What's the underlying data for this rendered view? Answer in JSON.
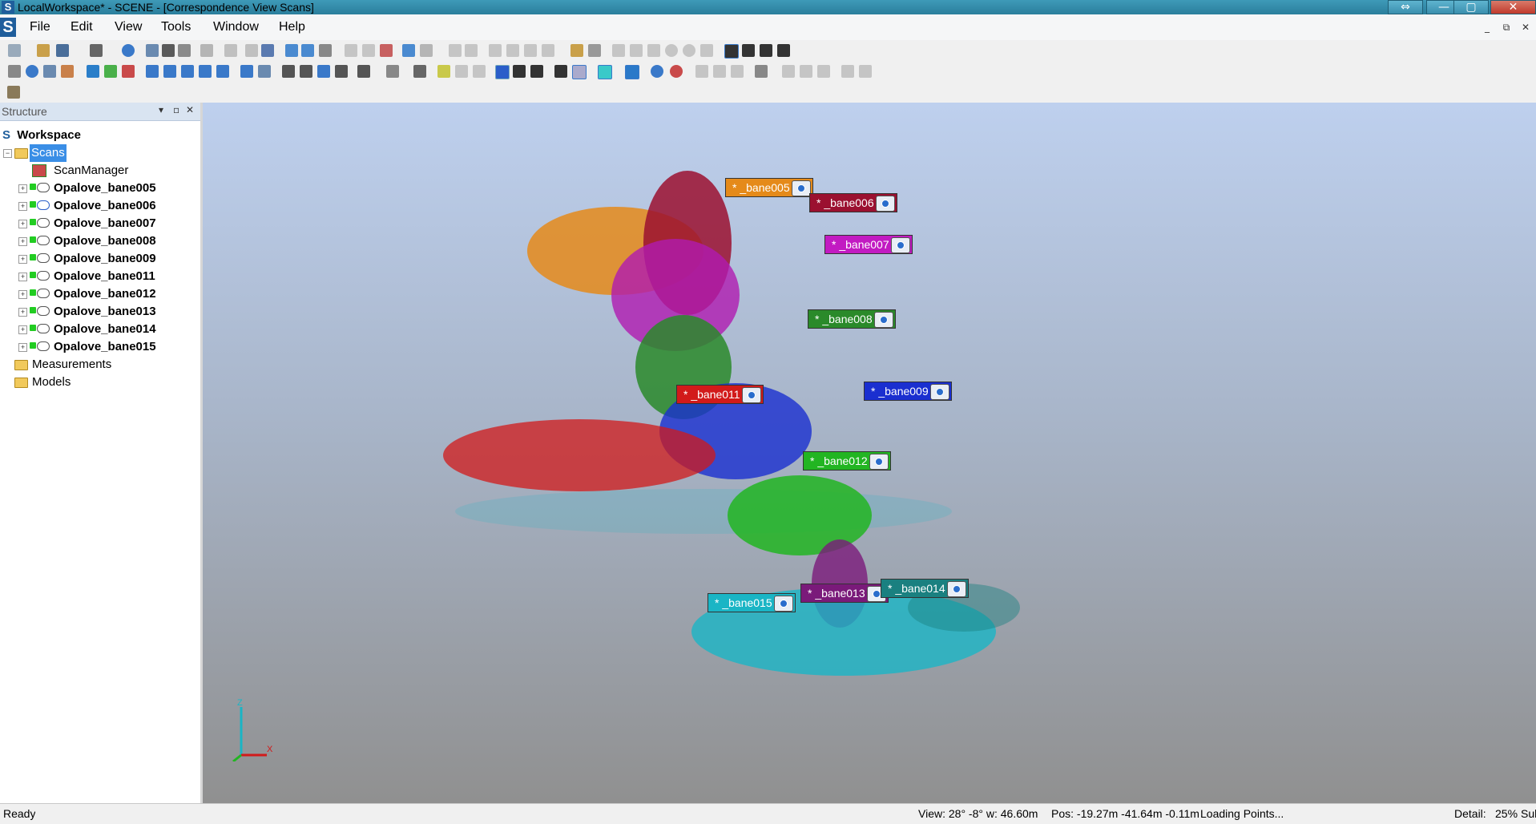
{
  "window": {
    "title": "LocalWorkspace* - SCENE - [Correspondence View Scans]",
    "restore_label": "⇔",
    "minimize_label": "—",
    "maximize_label": "▢",
    "close_label": "✕"
  },
  "menubar": {
    "items": [
      "File",
      "Edit",
      "View",
      "Tools",
      "Window",
      "Help"
    ],
    "mdi_minimize": "_",
    "mdi_restore": "⧉",
    "mdi_close": "✕"
  },
  "structure_panel": {
    "title": "Structure",
    "root": "Workspace",
    "scans_label": "Scans",
    "scan_manager": "ScanManager",
    "scans": [
      "Opalove_bane005",
      "Opalove_bane006",
      "Opalove_bane007",
      "Opalove_bane008",
      "Opalove_bane009",
      "Opalove_bane011",
      "Opalove_bane012",
      "Opalove_bane013",
      "Opalove_bane014",
      "Opalove_bane015"
    ],
    "measurements": "Measurements",
    "models": "Models"
  },
  "viewport": {
    "scan_tags": [
      {
        "label": "* _bane005",
        "color": "#e58a1a"
      },
      {
        "label": "* _bane006",
        "color": "#9b1030"
      },
      {
        "label": "* _bane007",
        "color": "#c21ac2"
      },
      {
        "label": "* _bane008",
        "color": "#2a8a2a"
      },
      {
        "label": "* _bane009",
        "color": "#1a2fd0"
      },
      {
        "label": "* _bane011",
        "color": "#d21a1a"
      },
      {
        "label": "* _bane012",
        "color": "#22b522"
      },
      {
        "label": "* _bane013",
        "color": "#7a1a7a"
      },
      {
        "label": "* _bane014",
        "color": "#1a8080"
      },
      {
        "label": "* _bane015",
        "color": "#1ab5c5"
      }
    ],
    "axis": {
      "z": "Z",
      "x": "X"
    }
  },
  "statusbar": {
    "state": "Ready",
    "view": "View: 28° -8° w: 46.60m",
    "pos": "Pos: -19.27m -41.64m -0.11m",
    "loading": "Loading Points...",
    "detail_label": "Detail:",
    "detail_value": "25%",
    "extra": "Sul"
  }
}
